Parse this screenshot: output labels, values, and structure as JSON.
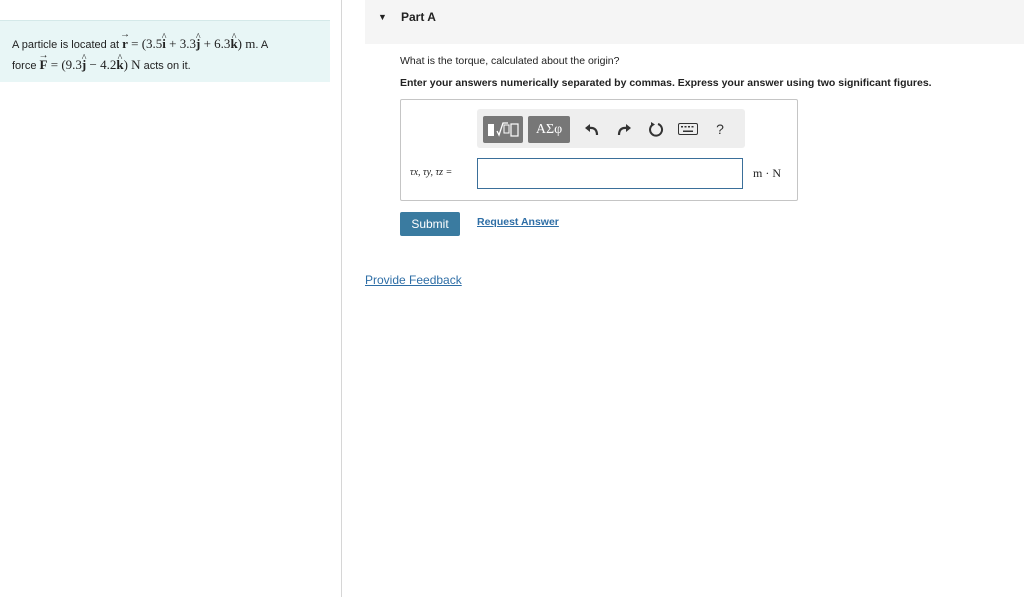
{
  "problem": {
    "t1": "A particle is located at ",
    "r_symbol": "r",
    "eq": " = ",
    "r_open": "(3.5",
    "i_hat": "i",
    "r_plus1": " + 3.3",
    "j_hat": "j",
    "r_plus2": " + 6.3",
    "k_hat": "k",
    "r_close": ")",
    "r_unit": " m",
    "t2": ". A",
    "t3": "force ",
    "f_symbol": "F",
    "f_open": "(9.3",
    "f_minus": " − 4.2",
    "f_close": ")",
    "f_unit": " N",
    "t4": " acts on it."
  },
  "part": {
    "title": "Part A",
    "question": "What is the torque, calculated about the origin?",
    "instruction": "Enter your answers numerically separated by commas. Express your answer using two significant figures."
  },
  "answer": {
    "variables": "τx, τy, τz =",
    "value": "",
    "units": "m · N"
  },
  "toolbar": {
    "greek_label": "ΑΣφ",
    "help_label": "?"
  },
  "actions": {
    "submit": "Submit",
    "request_answer": "Request Answer",
    "feedback": "Provide Feedback"
  },
  "colors": {
    "accent": "#3a7ba0",
    "link": "#2e6ea6",
    "problem_bg": "#e8f6f6"
  }
}
